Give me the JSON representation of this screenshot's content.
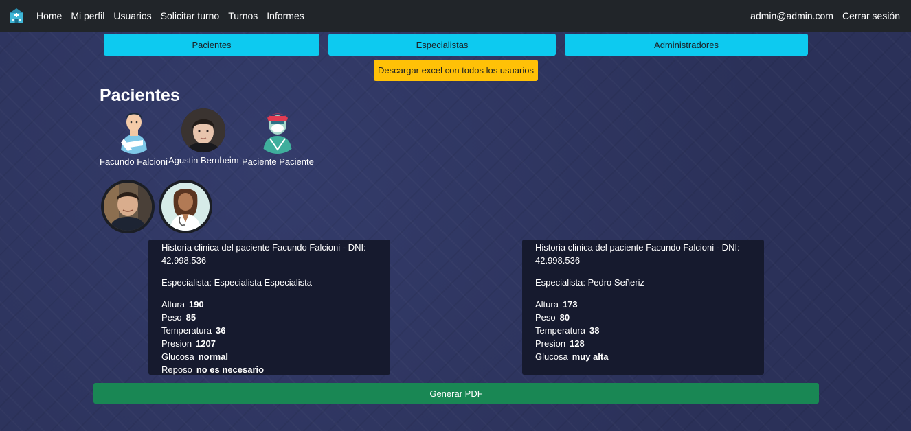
{
  "nav": {
    "links": [
      "Home",
      "Mi perfil",
      "Usuarios",
      "Solicitar turno",
      "Turnos",
      "Informes"
    ],
    "user_email": "admin@admin.com",
    "logout": "Cerrar sesión"
  },
  "tabs": {
    "patients": "Pacientes",
    "specialists": "Especialistas",
    "admins": "Administradores"
  },
  "excel_button": "Descargar excel con todos los usuarios",
  "section_title": "Pacientes",
  "patients": [
    {
      "name": "Facundo Falcioni",
      "icon": "patient-bandage-icon"
    },
    {
      "name": "Agustin Bernheim",
      "icon": "photo-avatar"
    },
    {
      "name": "Paciente Paciente",
      "icon": "patient-mask-icon"
    }
  ],
  "histories": [
    {
      "title": "Historia clinica del paciente Facundo Falcioni - DNI: 42.998.536",
      "specialist": "Especialista: Especialista Especialista",
      "rows": [
        {
          "label": "Altura",
          "value": "190"
        },
        {
          "label": "Peso",
          "value": "85"
        },
        {
          "label": "Temperatura",
          "value": "36"
        },
        {
          "label": "Presion",
          "value": "1207"
        },
        {
          "label": "Glucosa",
          "value": "normal"
        },
        {
          "label": "Reposo",
          "value": "no es necesario"
        }
      ]
    },
    {
      "title": "Historia clinica del paciente Facundo Falcioni - DNI: 42.998.536",
      "specialist": "Especialista: Pedro Señeriz",
      "rows": [
        {
          "label": "Altura",
          "value": "173"
        },
        {
          "label": "Peso",
          "value": "80"
        },
        {
          "label": "Temperatura",
          "value": "38"
        },
        {
          "label": "Presion",
          "value": "128"
        },
        {
          "label": "Glucosa",
          "value": "muy alta"
        }
      ]
    }
  ],
  "pdf_button": "Generar PDF",
  "colors": {
    "navbar": "#212529",
    "info": "#0dcaf0",
    "warning": "#ffc107",
    "success": "#198754",
    "card": "#161a2e",
    "background": "#2e3560"
  }
}
